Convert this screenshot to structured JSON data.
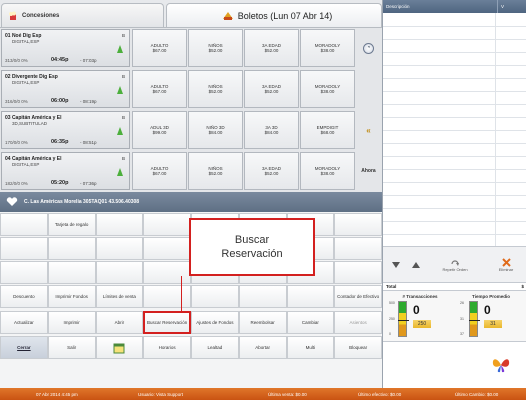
{
  "tabs": {
    "concessions": "Concesiones",
    "tickets": "Boletos (Lun 07 Abr 14)"
  },
  "movies": [
    {
      "title": "01 Noé Dig Esp",
      "format": "DIGITAL,ESP",
      "rating": "B",
      "seats": "313/0/0",
      "occupancy": "0%",
      "time": "04:45p",
      "end_time": "- 07:03p",
      "prices": [
        {
          "label": "ADULTO",
          "value": "$67.00"
        },
        {
          "label": "NIÑOS",
          "value": "$52.00"
        },
        {
          "label": "3A EDAD",
          "value": "$52.00"
        },
        {
          "label": "MORADOLY",
          "value": "$38.00"
        }
      ],
      "side": "◔"
    },
    {
      "title": "02 Divergente Dig Esp",
      "format": "DIGITAL,ESP",
      "rating": "B",
      "seats": "316/0/0",
      "occupancy": "0%",
      "time": "06:00p",
      "end_time": "- 08:19p",
      "prices": [
        {
          "label": "ADULTO",
          "value": "$67.00"
        },
        {
          "label": "NIÑOS",
          "value": "$52.00"
        },
        {
          "label": "3A EDAD",
          "value": "$52.00"
        },
        {
          "label": "MORADOLY",
          "value": "$38.00"
        }
      ],
      "side": ""
    },
    {
      "title": "03 Capitán América y El",
      "format": "3D,SUBTITULAD",
      "rating": "B",
      "seats": "170/0/0",
      "occupancy": "0%",
      "time": "06:35p",
      "end_time": "- 08:51p",
      "prices": [
        {
          "label": "ADUL 3D",
          "value": "$99.00"
        },
        {
          "label": "NIÑO 3D",
          "value": "$84.00"
        },
        {
          "label": "3A 3D",
          "value": "$84.00"
        },
        {
          "label": "EMPDIGIT",
          "value": "$68.00"
        }
      ],
      "side": "«"
    },
    {
      "title": "04 Capitán América y El",
      "format": "DIGITAL,ESP",
      "rating": "B",
      "seats": "182/0/0",
      "occupancy": "0%",
      "time": "05:20p",
      "end_time": "- 07:36p",
      "prices": [
        {
          "label": "ADULTO",
          "value": "$67.00"
        },
        {
          "label": "NIÑOS",
          "value": "$52.00"
        },
        {
          "label": "3A EDAD",
          "value": "$52.00"
        },
        {
          "label": "MORADOLY",
          "value": "$38.00"
        }
      ],
      "side": "Ahora"
    }
  ],
  "banner": {
    "text": "C. Las Américas Morelia   305TAQ01   43.506.40308"
  },
  "callout": {
    "line1": "Buscar",
    "line2": "Reservación"
  },
  "grid": {
    "row1": [
      "",
      "Tarjeta de regalo",
      "",
      "",
      "",
      "",
      "",
      ""
    ],
    "row_descuento": [
      "Descuento",
      "Imprimir Fondos",
      "Límites de venta",
      "",
      "",
      "",
      "",
      "Contador de Efectivo"
    ],
    "row_actualizar": [
      "Actualizar",
      "Imprimir",
      "Abrir",
      "Buscar Reservación",
      "Ajustes de Fondos",
      "Reembolsar",
      "Cambiar",
      "Asientos"
    ],
    "row_cerrar": [
      "Cerrar",
      "Salir",
      "",
      "Horarios",
      "Lealtad",
      "Abortar",
      "Multi",
      "Bloquear"
    ]
  },
  "right_panel": {
    "col_description": "Descripción",
    "col_value": "V",
    "actions": {
      "repeat": "Repetir Orden",
      "delete": "Eliminar"
    },
    "total_label": "Total",
    "total_value": "$",
    "stats": {
      "transactions": {
        "title": "# Transacciones",
        "value": "0",
        "sub": "250",
        "scale_top": "500",
        "scale_mid": "250",
        "scale_bot": "0"
      },
      "avg_time": {
        "title": "Tiempo Promedio",
        "value": "0",
        "sub": "31",
        "scale_top": "26",
        "scale_mid": "31",
        "scale_bot": "37"
      }
    }
  },
  "status": {
    "datetime": "07 Abr 2014 4:45 pm",
    "user": "Usuario: Vista Support",
    "last_sale": "Última venta: $0.00",
    "last_given": "Último efectivo: $0.00",
    "last_change": "Último Cambio: $0.00"
  },
  "colors": {
    "highlight": "#d3201f",
    "status_bar": "#d9661f",
    "header_blue": "#5d7390"
  }
}
